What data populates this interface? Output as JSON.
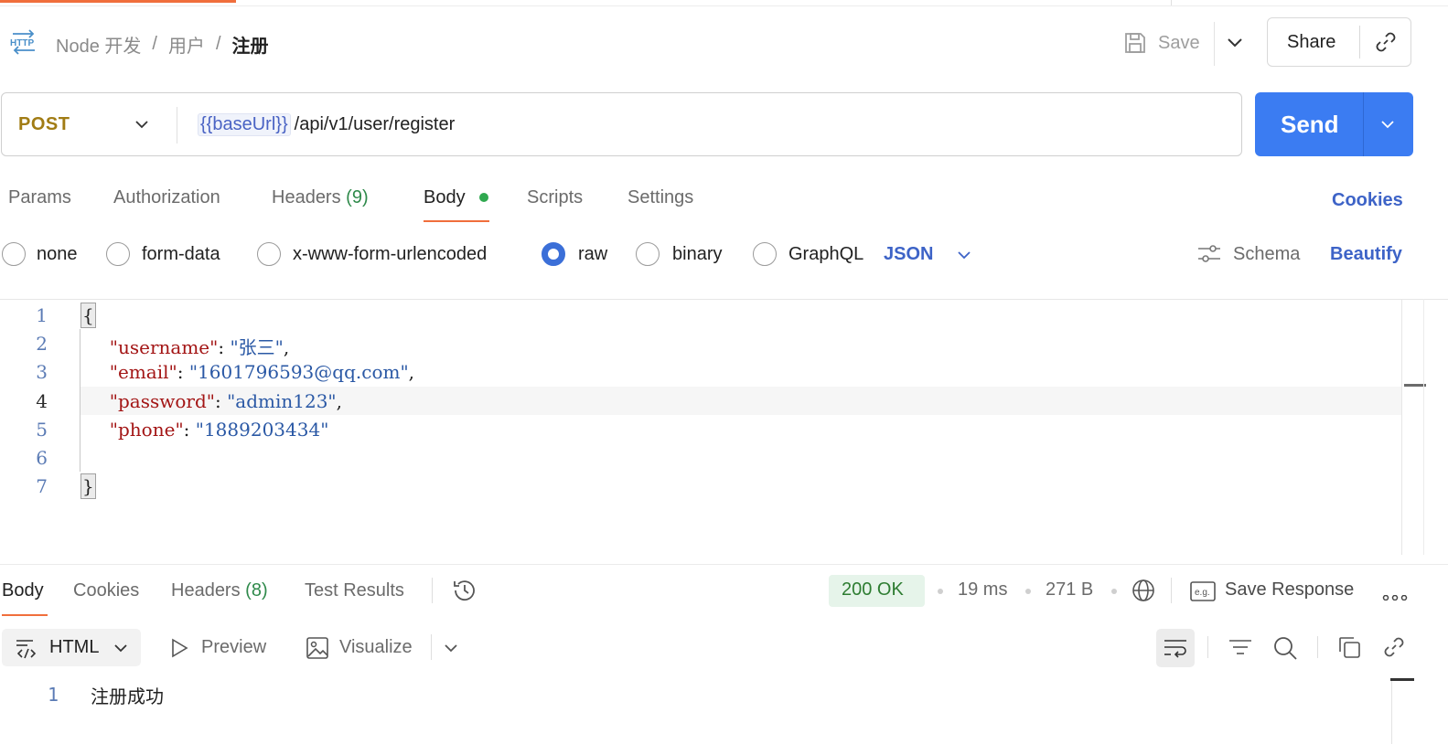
{
  "breadcrumb": {
    "collection": "Node 开发",
    "folder": "用户",
    "request": "注册",
    "separator": "/"
  },
  "header": {
    "save_label": "Save",
    "share_label": "Share"
  },
  "request": {
    "method": "POST",
    "url_variable": "{{baseUrl}}",
    "url_path": "/api/v1/user/register",
    "send_label": "Send"
  },
  "request_tabs": {
    "params": "Params",
    "authorization": "Authorization",
    "headers": "Headers",
    "headers_count": "(9)",
    "body": "Body",
    "scripts": "Scripts",
    "settings": "Settings",
    "cookies": "Cookies"
  },
  "body_types": {
    "none": "none",
    "form_data": "form-data",
    "urlencoded": "x-www-form-urlencoded",
    "raw": "raw",
    "binary": "binary",
    "graphql": "GraphQL",
    "selected": "raw",
    "format": "JSON"
  },
  "body_actions": {
    "schema": "Schema",
    "beautify": "Beautify"
  },
  "editor": {
    "line_numbers": [
      "1",
      "2",
      "3",
      "4",
      "5",
      "6",
      "7"
    ],
    "open_brace": "{",
    "close_brace": "}",
    "fields": [
      {
        "key": "\"username\"",
        "value": "\"张三\"",
        "comma": ","
      },
      {
        "key": "\"email\"",
        "value": "\"1601796593@qq.com\"",
        "comma": ","
      },
      {
        "key": "\"password\"",
        "value": "\"admin123\"",
        "comma": ","
      },
      {
        "key": "\"phone\"",
        "value": "\"1889203434\"",
        "comma": ""
      }
    ],
    "colon": ": "
  },
  "response_tabs": {
    "body": "Body",
    "cookies": "Cookies",
    "headers": "Headers",
    "headers_count": "(8)",
    "test_results": "Test Results"
  },
  "response_meta": {
    "status": "200 OK",
    "time": "19 ms",
    "size": "271 B",
    "save_response": "Save Response"
  },
  "response_toolbar": {
    "format": "HTML",
    "preview": "Preview",
    "visualize": "Visualize"
  },
  "response_body": {
    "line_number": "1",
    "text": "注册成功"
  },
  "colors": {
    "accent_orange": "#f06e3c",
    "send_blue": "#3b7cf2",
    "link_blue": "#3d63c7",
    "method_post": "#a17c14",
    "status_green": "#2e7d32",
    "json_key": "#a31515",
    "json_string": "#2a58a5"
  },
  "icons": [
    "http-icon",
    "save-icon",
    "chevron-down-icon",
    "link-icon",
    "schema-sliders-icon",
    "history-icon",
    "globe-icon",
    "example-icon",
    "more-icon",
    "code-format-icon",
    "preview-play-icon",
    "image-icon",
    "wrap-lines-icon",
    "filter-icon",
    "search-icon",
    "copy-icon"
  ]
}
